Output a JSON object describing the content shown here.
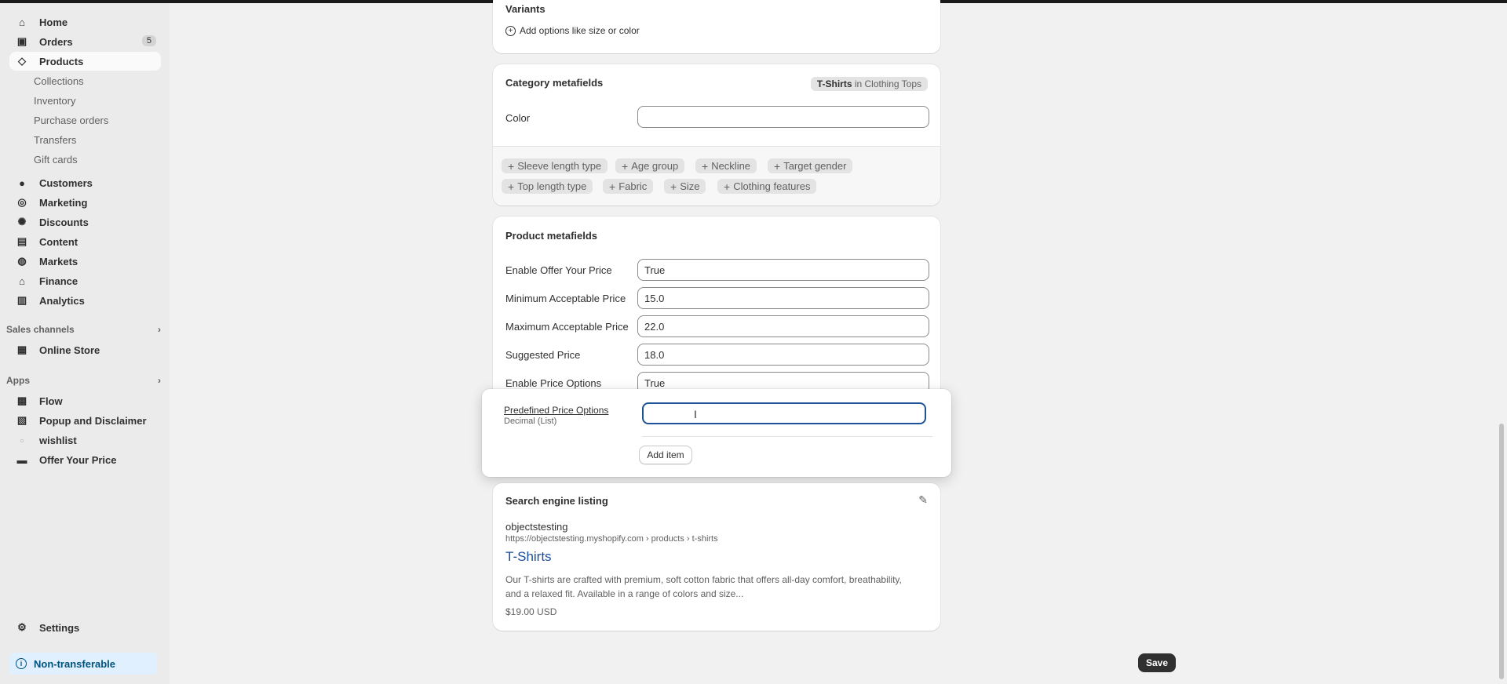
{
  "sidebar": {
    "nav": [
      {
        "label": "Home",
        "icon": "home-icon"
      },
      {
        "label": "Orders",
        "icon": "inbox-icon",
        "badge": "5"
      },
      {
        "label": "Products",
        "icon": "tag-icon"
      }
    ],
    "products_sub": [
      "Collections",
      "Inventory",
      "Purchase orders",
      "Transfers",
      "Gift cards"
    ],
    "nav2": [
      {
        "label": "Customers",
        "icon": "person-icon"
      },
      {
        "label": "Marketing",
        "icon": "target-icon"
      },
      {
        "label": "Discounts",
        "icon": "discount-icon"
      },
      {
        "label": "Content",
        "icon": "content-icon"
      },
      {
        "label": "Markets",
        "icon": "globe-icon"
      },
      {
        "label": "Finance",
        "icon": "bank-icon"
      },
      {
        "label": "Analytics",
        "icon": "chart-icon"
      }
    ],
    "sales_channels_label": "Sales channels",
    "online_store": "Online Store",
    "apps_label": "Apps",
    "apps": [
      "Flow",
      "Popup and Disclaimer",
      "wishlist",
      "Offer Your Price"
    ],
    "settings": "Settings",
    "non_transferable": "Non-transferable"
  },
  "variants": {
    "title": "Variants",
    "add_options": "Add options like size or color"
  },
  "category_metafields": {
    "title": "Category metafields",
    "tag_bold": "T-Shirts",
    "tag_rest": " in Clothing Tops",
    "color_label": "Color",
    "color_value": "",
    "pills_row1": [
      "Sleeve length type",
      "Age group",
      "Neckline",
      "Target gender"
    ],
    "pills_row2": [
      "Top length type",
      "Fabric",
      "Size",
      "Clothing features"
    ]
  },
  "product_metafields": {
    "title": "Product metafields",
    "rows": [
      {
        "label": "Enable Offer Your Price",
        "value": "True"
      },
      {
        "label": "Minimum Acceptable Price",
        "value": "15.0"
      },
      {
        "label": "Maximum Acceptable Price",
        "value": "22.0"
      },
      {
        "label": "Suggested Price",
        "value": "18.0"
      },
      {
        "label": "Enable Price Options",
        "value": "True"
      }
    ]
  },
  "popover": {
    "label": "Predefined Price Options",
    "type": "Decimal (List)",
    "value": "",
    "add_item": "Add item"
  },
  "seo": {
    "title": "Search engine listing",
    "store": "objectstesting",
    "url": "https://objectstesting.myshopify.com › products › t-shirts",
    "page_title": "T-Shirts",
    "description_line1": "Our T-shirts are crafted with premium, soft cotton fabric that offers all-day comfort, breathability,",
    "description_line2": "and a relaxed fit. Available in a range of colors and size...",
    "price": "$19.00 USD"
  },
  "save_label": "Save",
  "colors": {
    "accent": "#1f5199",
    "link": "#005bd3",
    "sidebar_bg": "#ebebeb",
    "page_bg": "#f1f1f1"
  }
}
